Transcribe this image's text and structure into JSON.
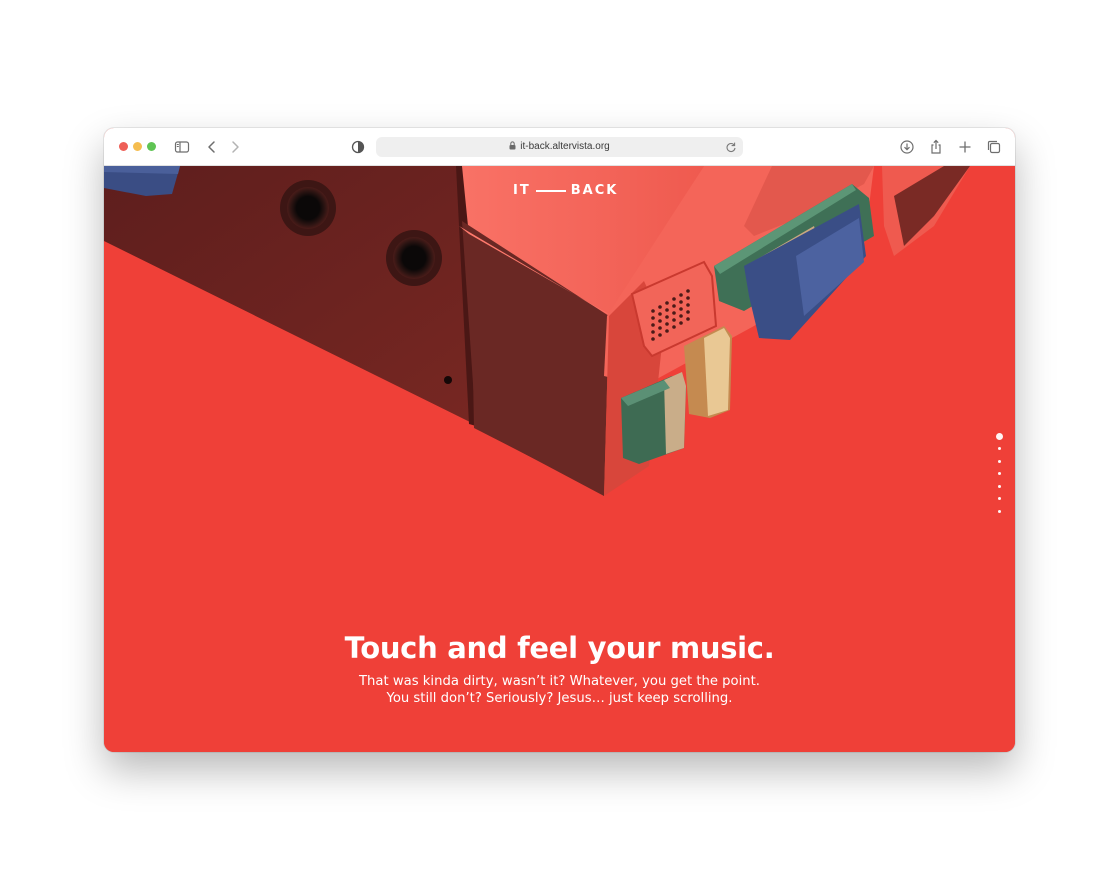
{
  "browser": {
    "url": "it-back.altervista.org"
  },
  "site": {
    "logo_left": "IT",
    "logo_right": "BACK",
    "headline": "Touch and feel your music.",
    "subtext_line1": "That was kinda dirty, wasn’t it? Whatever, you get the point.",
    "subtext_line2": "You still don’t? Seriously? Jesus… just keep scrolling.",
    "pager": {
      "count": 7,
      "active_index": 0
    }
  },
  "colors": {
    "background": "#ef4038",
    "device_body": "#f26a5f",
    "device_shadow": "#66241f"
  }
}
